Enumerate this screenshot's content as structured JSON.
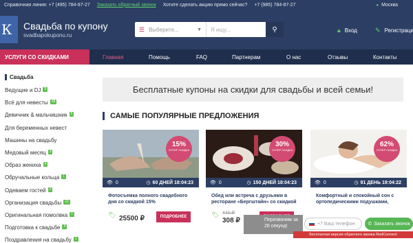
{
  "topbar": {
    "hotline": "Справочная линия: +7 (495) 784-87-27",
    "callback_link": "Заказать обратный звонок",
    "promo": "Хотите сделать акцию прямо сейчас?",
    "phone2": "+7 (985) 784-87-27",
    "city": "Москва"
  },
  "header": {
    "logo_mark": "К",
    "site_title": "Свадьба по купону",
    "site_domain": "svadbapokuponu.ru",
    "search_select": "Выберите...",
    "search_placeholder": "Я ищу...",
    "login_label": "Вход",
    "register_label": "Регистрация"
  },
  "nav": {
    "services_label": "УСЛУГИ СО СКИДКАМИ",
    "items": [
      {
        "label": "Главная",
        "active": true
      },
      {
        "label": "Помощь"
      },
      {
        "label": "FAQ"
      },
      {
        "label": "Партнерам"
      },
      {
        "label": "О нас"
      },
      {
        "label": "Отзывы"
      },
      {
        "label": "Контакты"
      }
    ]
  },
  "sidebar": {
    "title": "Свадьба",
    "items": [
      {
        "label": "Ведущие и DJ",
        "badge": "5"
      },
      {
        "label": "Всё для невесты",
        "badge": "38"
      },
      {
        "label": "Девичник & мальчишник",
        "badge": "5"
      },
      {
        "label": "Для беременных невест",
        "badge": ""
      },
      {
        "label": "Машины на свадьбу",
        "badge": ""
      },
      {
        "label": "Медовый месяц",
        "badge": "3"
      },
      {
        "label": "Образ жениха",
        "badge": "4"
      },
      {
        "label": "Обручальные кольца",
        "badge": "1"
      },
      {
        "label": "Одеваем гостей",
        "badge": "2"
      },
      {
        "label": "Организация свадьбы",
        "badge": "21"
      },
      {
        "label": "Оригинальная помолвка",
        "badge": "1"
      },
      {
        "label": "Подготовка к свадьбе",
        "badge": "4"
      },
      {
        "label": "Поздравления на свадьбу",
        "badge": "1"
      }
    ]
  },
  "banner": "Бесплатные купоны на скидки для свадьбы и всей семьи!",
  "section_title": "САМЫЕ ПОПУЛЯРНЫЕ ПРЕДЛОЖЕНИЯ",
  "cards": [
    {
      "discount": "15%",
      "discount_label": "СУПЕР СКИДКА",
      "views": "0",
      "time_left": "60 ДНЕЙ 18:04:23",
      "title": "Фотосъемка полного свадебного дня со скидкой 15%",
      "old_price": "",
      "price": "25500 ₽",
      "button": "ПОДРОБНЕЕ"
    },
    {
      "discount": "30%",
      "discount_label": "СУПЕР СКИДКА",
      "views": "0",
      "time_left": "150 ДНЕЙ 18:04:23",
      "title": "Обед или встреча с друзьями в ресторане «Бергштайн» со скидкой",
      "old_price": "440 ₽",
      "price": "308 ₽",
      "button": "ПОДРОБНЕЕ"
    },
    {
      "discount": "62%",
      "discount_label": "СУПЕР СКИДКА",
      "views": "0",
      "time_left": "91 ДЕНЬ 19:04:22",
      "title": "Комфортный и спокойный сон с ортопедическими подушками,",
      "old_price": "",
      "price": "",
      "button": ""
    }
  ],
  "callback": {
    "prompt": "Перезвоним за 28 секунд!",
    "phone_placeholder": "+7 Ваш телефон",
    "call_button": "Заказать звонок",
    "note": "Бесплатная версия обратного звонка RedConnect"
  },
  "colors": {
    "navy": "#2c3e63",
    "accent": "#c9305a",
    "green": "#5fbf4f"
  }
}
